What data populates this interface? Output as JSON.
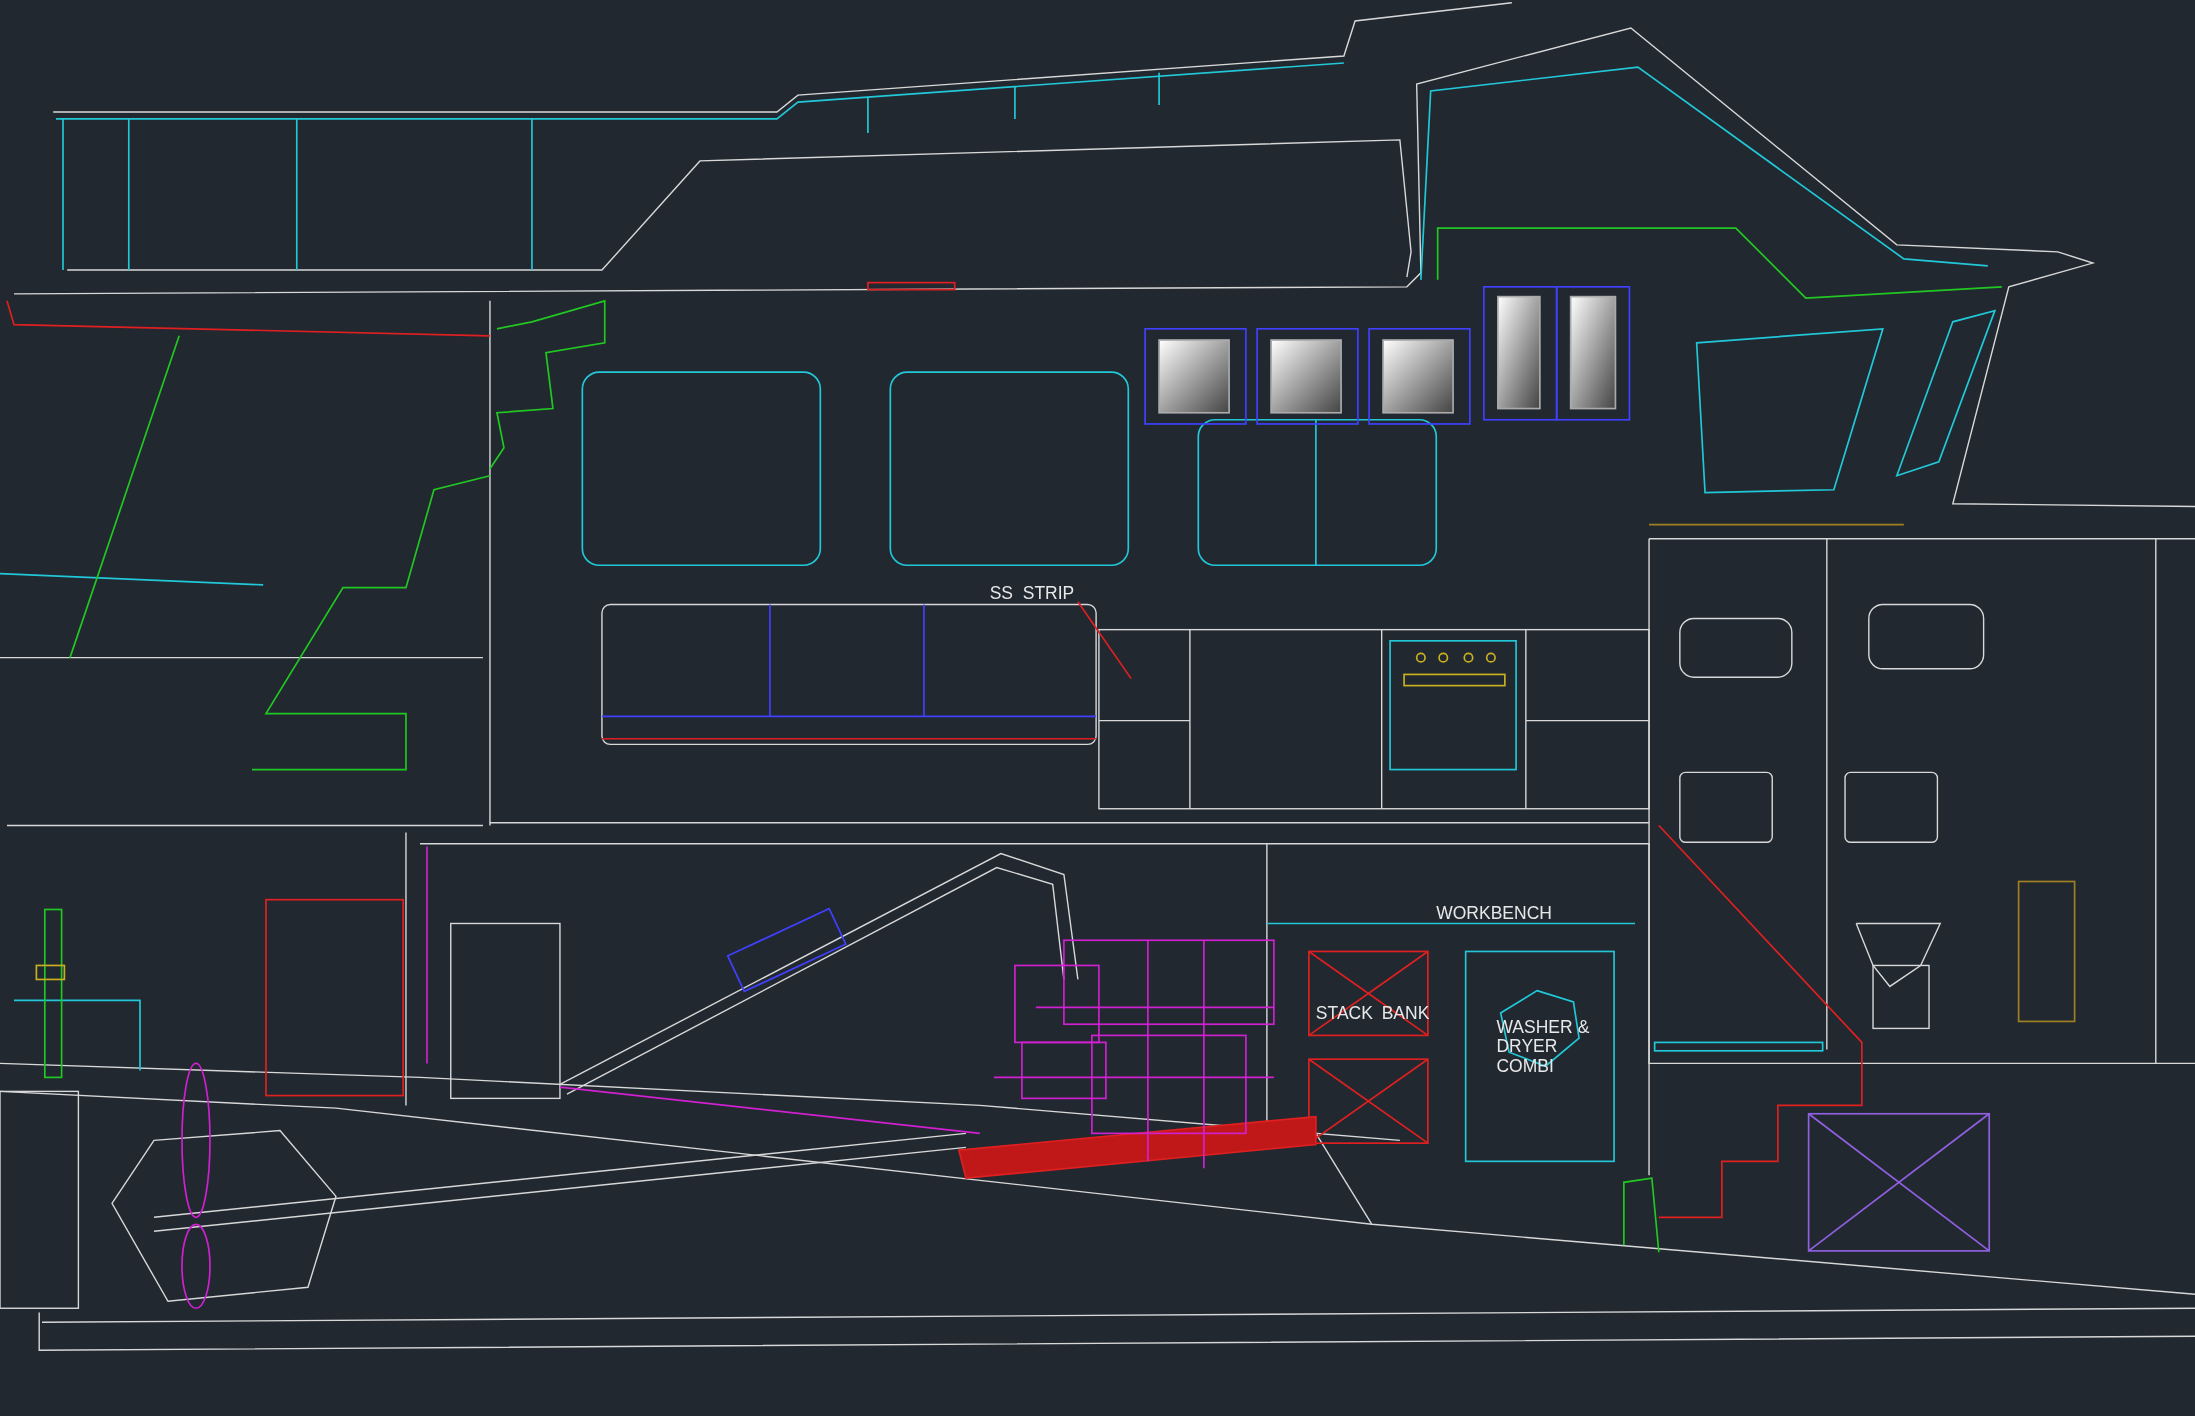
{
  "canvas": {
    "labels": [
      {
        "text": "SS  STRIP"
      },
      {
        "text": "WORKBENCH"
      },
      {
        "text": "STACK"
      },
      {
        "text": "BANK"
      },
      {
        "text": "WASHER"
      },
      {
        "text": "&"
      },
      {
        "text": "DRYER"
      },
      {
        "text": "COMBI"
      }
    ]
  }
}
